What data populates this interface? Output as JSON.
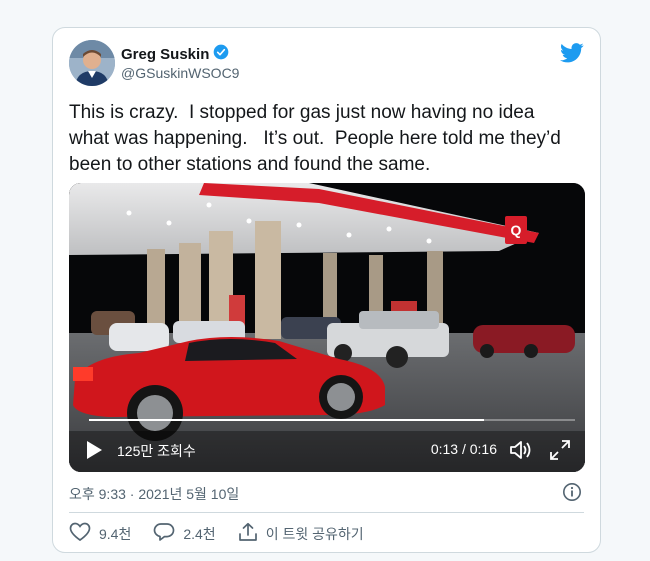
{
  "author": {
    "name": "Greg Suskin",
    "handle": "@GSuskinWSOC9",
    "verified": true
  },
  "tweet": {
    "text": "This is crazy.  I stopped for gas just now having no idea what was happening.   It’s out.  People here told me they’d been to other stations and found the same."
  },
  "video": {
    "views": "125만 조회수",
    "time": "0:13 / 0:16",
    "progress": 0.8125
  },
  "meta": {
    "timestamp": "오후 9:33 · 2021년 5월 10일"
  },
  "actions": {
    "likes": "9.4천",
    "replies": "2.4천",
    "share": "이 트윗 공유하기"
  },
  "colors": {
    "twitter_blue": "#1d9bf0",
    "text": "#14171a",
    "muted": "#536471"
  },
  "icons": [
    "twitter-bird-icon",
    "verified-badge-icon",
    "play-icon",
    "volume-icon",
    "fullscreen-icon",
    "info-icon",
    "heart-icon",
    "reply-icon",
    "share-icon"
  ]
}
